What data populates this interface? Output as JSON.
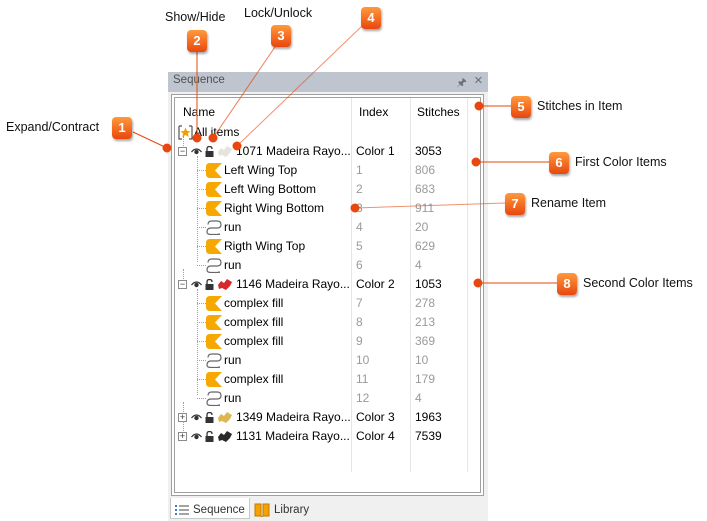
{
  "panel": {
    "title": "Sequence",
    "pin_icon": "pin-icon",
    "close_icon": "close-icon",
    "columns": [
      "Name",
      "Index",
      "Stitches"
    ],
    "root": {
      "label": "All items",
      "icon": "star-icon"
    },
    "groups": [
      {
        "name": "1071 Madeira Rayo...",
        "index": "Color 1",
        "stitches": "3053",
        "expanded": true,
        "design_color": "#e8e4dc",
        "children": [
          {
            "type": "fill",
            "name": "Left Wing Top",
            "index": "1",
            "stitches": "806"
          },
          {
            "type": "fill",
            "name": "Left Wing Bottom",
            "index": "2",
            "stitches": "683"
          },
          {
            "type": "fill",
            "name": "Right Wing Bottom",
            "index": "3",
            "stitches": "911"
          },
          {
            "type": "run",
            "name": "run",
            "index": "4",
            "stitches": "20"
          },
          {
            "type": "fill",
            "name": "Rigth Wing Top",
            "index": "5",
            "stitches": "629"
          },
          {
            "type": "run",
            "name": "run",
            "index": "6",
            "stitches": "4"
          }
        ]
      },
      {
        "name": "1146 Madeira Rayo...",
        "index": "Color 2",
        "stitches": "1053",
        "expanded": true,
        "design_color": "#d42a2a",
        "children": [
          {
            "type": "fill",
            "name": "complex fill",
            "index": "7",
            "stitches": "278"
          },
          {
            "type": "fill",
            "name": "complex fill",
            "index": "8",
            "stitches": "213"
          },
          {
            "type": "fill",
            "name": "complex fill",
            "index": "9",
            "stitches": "369"
          },
          {
            "type": "run",
            "name": "run",
            "index": "10",
            "stitches": "10"
          },
          {
            "type": "fill",
            "name": "complex fill",
            "index": "11",
            "stitches": "179"
          },
          {
            "type": "run",
            "name": "run",
            "index": "12",
            "stitches": "4"
          }
        ]
      },
      {
        "name": "1349 Madeira Rayo...",
        "index": "Color 3",
        "stitches": "1963",
        "expanded": false,
        "design_color": "#e0b650",
        "children": []
      },
      {
        "name": "1131 Madeira Rayo...",
        "index": "Color 4",
        "stitches": "7539",
        "expanded": false,
        "design_color": "#2a2a2a",
        "children": []
      }
    ],
    "tabs": [
      {
        "label": "Sequence",
        "icon": "list-icon",
        "active": true
      },
      {
        "label": "Library",
        "icon": "book-icon",
        "active": false
      }
    ]
  },
  "callouts": [
    {
      "number": "1",
      "label": "Expand/Contract"
    },
    {
      "number": "2",
      "label": "Show/Hide"
    },
    {
      "number": "3",
      "label": "Lock/Unlock"
    },
    {
      "number": "4",
      "label": ""
    },
    {
      "number": "5",
      "label": "Stitches in Item"
    },
    {
      "number": "6",
      "label": "First Color Items"
    },
    {
      "number": "7",
      "label": "Rename Item"
    },
    {
      "number": "8",
      "label": "Second Color Items"
    }
  ],
  "colors": {
    "accent": "#e8470f",
    "fill_icon": "#f7a800",
    "title_bar": "#bfc5cf"
  }
}
